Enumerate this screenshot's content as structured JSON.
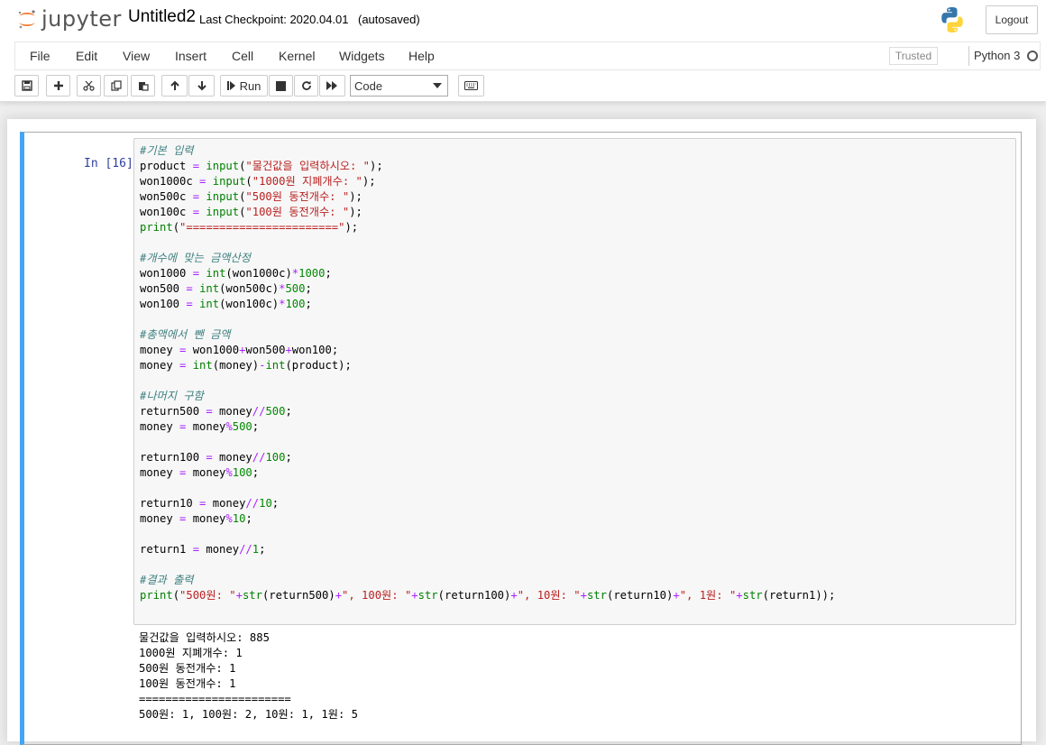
{
  "header": {
    "logo_text": "jupyter",
    "notebook_title": "Untitled2",
    "checkpoint": "Last Checkpoint: 2020.04.01",
    "autosave_status": "(autosaved)",
    "logout_label": "Logout"
  },
  "menu": {
    "items": [
      "File",
      "Edit",
      "View",
      "Insert",
      "Cell",
      "Kernel",
      "Widgets",
      "Help"
    ],
    "trusted_label": "Trusted",
    "kernel_name": "Python 3"
  },
  "toolbar": {
    "run_label": "Run",
    "cell_type": "Code"
  },
  "cell": {
    "prompt": "In [16]:",
    "code_lines": [
      "#기본 입력",
      "product = input(\"물건값을 입력하시오: \");",
      "won1000c = input(\"1000원 지폐개수: \");",
      "won500c = input(\"500원 동전개수: \");",
      "won100c = input(\"100원 동전개수: \");",
      "print(\"=======================\");",
      "",
      "#개수에 맞는 금액산정",
      "won1000 = int(won1000c)*1000;",
      "won500 = int(won500c)*500;",
      "won100 = int(won100c)*100;",
      "",
      "#총액에서 뺀 금액",
      "money = won1000+won500+won100;",
      "money = int(money)-int(product);",
      "",
      "#나머지 구함",
      "return500 = money//500;",
      "money = money%500;",
      "",
      "return100 = money//100;",
      "money = money%100;",
      "",
      "return10 = money//10;",
      "money = money%10;",
      "",
      "return1 = money//1;",
      "",
      "#결과 출력",
      "print(\"500원: \"+str(return500)+\", 100원: \"+str(return100)+\", 10원: \"+str(return10)+\", 1원: \"+str(return1));"
    ],
    "output_lines": [
      "물건값을 입력하시오: 885",
      "1000원 지폐개수: 1",
      "500원 동전개수: 1",
      "100원 동전개수: 1",
      "=======================",
      "500원: 1, 100원: 2, 10원: 1, 1원: 5"
    ]
  }
}
